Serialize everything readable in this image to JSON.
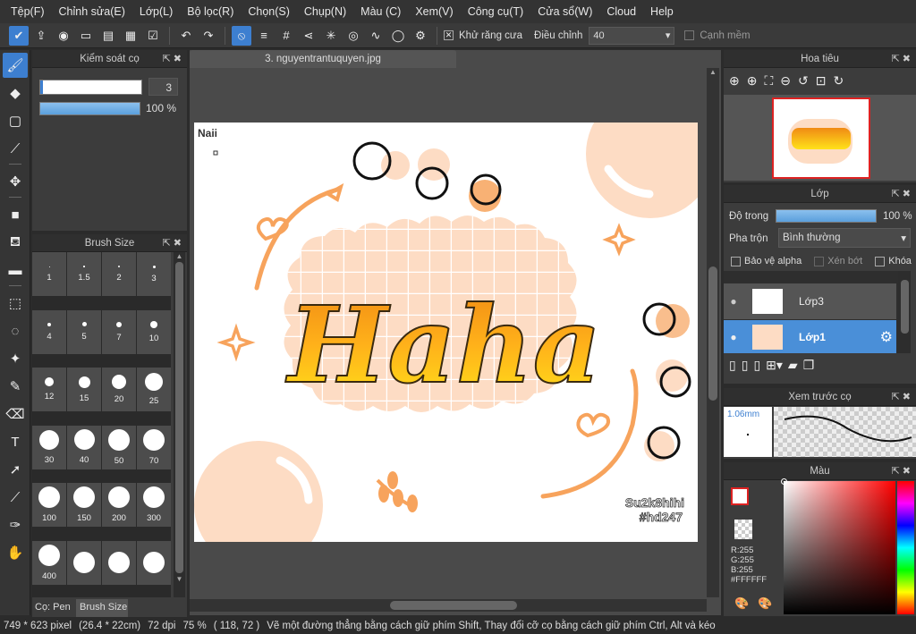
{
  "menu": [
    "Tệp(F)",
    "Chỉnh sửa(E)",
    "Lớp(L)",
    "Bộ lọc(R)",
    "Chọn(S)",
    "Chụp(N)",
    "Màu (C)",
    "Xem(V)",
    "Công cụ(T)",
    "Cửa sổ(W)",
    "Cloud",
    "Help"
  ],
  "toolbar": {
    "antialias": "Khử răng cưa",
    "adjust": "Điều chỉnh",
    "adjust_value": "40",
    "soft_edge": "Cạnh mềm"
  },
  "brush_control": {
    "title": "Kiểm soát cọ",
    "size": "3",
    "opacity": "100 %",
    "opacity_fraction": 1.0,
    "size_fraction": 0.03
  },
  "brush_size": {
    "title": "Brush Size",
    "tab_pen": "Cọ: Pen",
    "tab_size": "Brush Size",
    "sizes": [
      "1",
      "1.5",
      "2",
      "3",
      "4",
      "5",
      "7",
      "10",
      "12",
      "15",
      "20",
      "25",
      "30",
      "40",
      "50",
      "70",
      "100",
      "150",
      "200",
      "300",
      "400",
      "",
      "",
      ""
    ]
  },
  "document": {
    "tab": "3. nguyentrantuquyen.jpg",
    "corner_text": "Naii",
    "main_text": "Haha",
    "signature_1": "Su2k8hihi",
    "signature_2": "#hd247"
  },
  "navigator": {
    "title": "Hoa tiêu"
  },
  "layers": {
    "title": "Lớp",
    "opacity_label": "Độ trong",
    "opacity_value": "100 %",
    "opacity_fraction": 1.0,
    "blend_label": "Pha trộn",
    "blend_value": "Bình thường",
    "protect_alpha": "Bảo vệ alpha",
    "clip": "Xén bớt",
    "lock": "Khóa",
    "items": [
      {
        "name": "Lớp3",
        "selected": false
      },
      {
        "name": "Lớp1",
        "selected": true
      }
    ]
  },
  "brush_preview": {
    "title": "Xem trước cọ",
    "size": "1.06mm"
  },
  "color": {
    "title": "Màu",
    "r": "R:255",
    "g": "G:255",
    "b": "B:255",
    "hex": "#FFFFFF"
  },
  "status": {
    "dims": "749 * 623 pixel",
    "cm": "(26.4 * 22cm)",
    "dpi": "72 dpi",
    "zoom": "75 %",
    "coords": "( 118, 72 )",
    "hint": "Vẽ một đường thẳng bằng cách giữ phím Shift, Thay đổi cỡ cọ bằng cách giữ phím Ctrl, Alt và kéo"
  },
  "colors": {
    "accent": "#3d7fd0",
    "peach": "#fddcc4",
    "orange": "#f7a35c"
  }
}
